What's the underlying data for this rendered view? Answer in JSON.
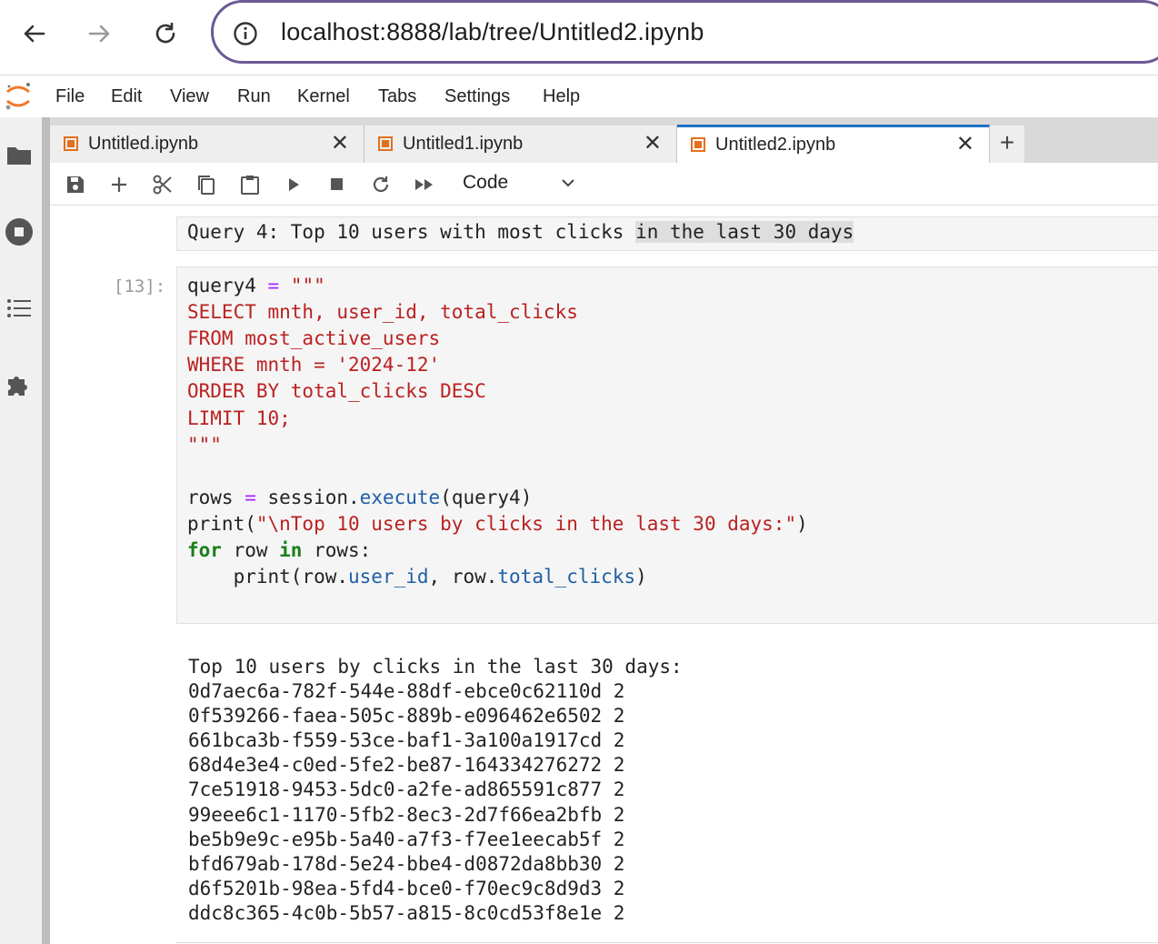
{
  "browser": {
    "url": "localhost:8888/lab/tree/Untitled2.ipynb"
  },
  "menu": [
    "File",
    "Edit",
    "View",
    "Run",
    "Kernel",
    "Tabs",
    "Settings",
    "Help"
  ],
  "tabs": [
    {
      "label": "Untitled.ipynb",
      "active": false
    },
    {
      "label": "Untitled1.ipynb",
      "active": false
    },
    {
      "label": "Untitled2.ipynb",
      "active": true
    }
  ],
  "toolbar": {
    "cell_type": "Code"
  },
  "markdown_cell": {
    "text_main": "Query 4: Top 10 users with most clicks ",
    "text_highlight": "in the last 30 days"
  },
  "code_cell": {
    "prompt": "[13]:",
    "lines": [
      {
        "segments": [
          {
            "t": "query4 ",
            "c": ""
          },
          {
            "t": "=",
            "c": "kw-op"
          },
          {
            "t": " \"\"\"",
            "c": "kw-str"
          }
        ]
      },
      {
        "segments": [
          {
            "t": "SELECT mnth, user_id, total_clicks",
            "c": "kw-str"
          }
        ]
      },
      {
        "segments": [
          {
            "t": "FROM most_active_users",
            "c": "kw-str"
          }
        ]
      },
      {
        "segments": [
          {
            "t": "WHERE mnth = '2024-12'",
            "c": "kw-str"
          }
        ]
      },
      {
        "segments": [
          {
            "t": "ORDER BY total_clicks DESC",
            "c": "kw-str"
          }
        ]
      },
      {
        "segments": [
          {
            "t": "LIMIT 10;",
            "c": "kw-str"
          }
        ]
      },
      {
        "segments": [
          {
            "t": "\"\"\"",
            "c": "kw-str"
          }
        ]
      },
      {
        "segments": []
      },
      {
        "segments": [
          {
            "t": "rows ",
            "c": ""
          },
          {
            "t": "=",
            "c": "kw-op"
          },
          {
            "t": " session.",
            "c": ""
          },
          {
            "t": "execute",
            "c": "kw-fn"
          },
          {
            "t": "(query4)",
            "c": ""
          }
        ]
      },
      {
        "segments": [
          {
            "t": "print(",
            "c": ""
          },
          {
            "t": "\"\\nTop 10 users by clicks in the last 30 days:\"",
            "c": "kw-str"
          },
          {
            "t": ")",
            "c": ""
          }
        ]
      },
      {
        "segments": [
          {
            "t": "for",
            "c": "kw-kw"
          },
          {
            "t": " row ",
            "c": ""
          },
          {
            "t": "in",
            "c": "kw-kw"
          },
          {
            "t": " rows:",
            "c": ""
          }
        ]
      },
      {
        "segments": [
          {
            "t": "    print(row.",
            "c": ""
          },
          {
            "t": "user_id",
            "c": "kw-fn"
          },
          {
            "t": ", row.",
            "c": ""
          },
          {
            "t": "total_clicks",
            "c": "kw-fn"
          },
          {
            "t": ")",
            "c": ""
          }
        ]
      }
    ]
  },
  "output": {
    "header": "Top 10 users by clicks in the last 30 days:",
    "rows": [
      "0d7aec6a-782f-544e-88df-ebce0c62110d 2",
      "0f539266-faea-505c-889b-e096462e6502 2",
      "661bca3b-f559-53ce-baf1-3a100a1917cd 2",
      "68d4e3e4-c0ed-5fe2-be87-164334276272 2",
      "7ce51918-9453-5dc0-a2fe-ad865591c877 2",
      "99eee6c1-1170-5fb2-8ec3-2d7f66ea2bfb 2",
      "be5b9e9c-e95b-5a40-a7f3-f7ee1eecab5f 2",
      "bfd679ab-178d-5e24-bbe4-d0872da8bb30 2",
      "d6f5201b-98ea-5fd4-bce0-f70ec9c8d9d3 2",
      "ddc8c365-4c0b-5b57-a815-8c0cd53f8e1e 2"
    ]
  },
  "colors": {
    "accent": "#1e72c6",
    "url_border": "#6a5a95",
    "tab_icon": "#e3701f"
  },
  "icons": {
    "nav": [
      "back-arrow-icon",
      "forward-arrow-icon",
      "reload-icon"
    ],
    "rail": [
      "folder-icon",
      "stop-circle-icon",
      "list-icon",
      "puzzle-icon"
    ],
    "toolbar": [
      "save-icon",
      "plus-icon",
      "scissors-icon",
      "copy-icon",
      "paste-icon",
      "run-icon",
      "stop-icon",
      "restart-icon",
      "fast-forward-icon"
    ]
  }
}
